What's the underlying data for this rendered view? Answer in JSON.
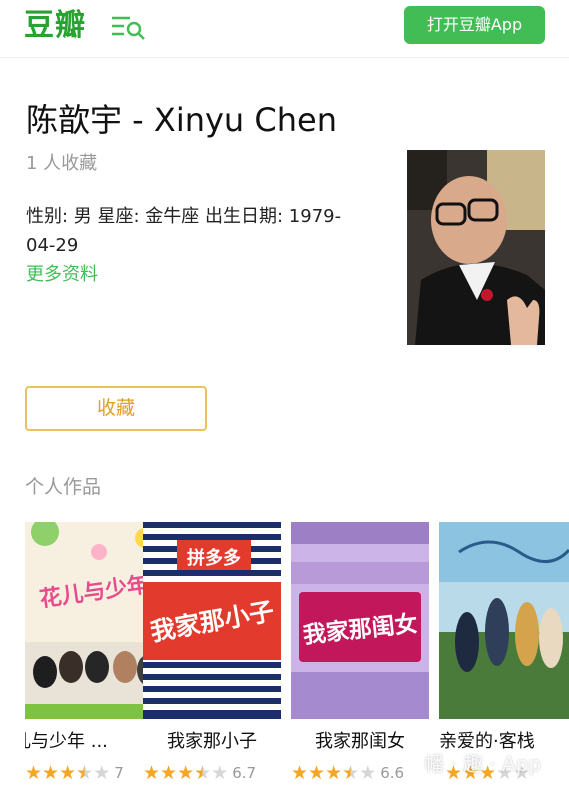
{
  "header": {
    "logo": "豆瓣",
    "menu_search_icon": "menu-search-icon",
    "open_app_label": "打开豆瓣App"
  },
  "person": {
    "name": "陈歆宇 - Xinyu Chen",
    "fav_count": "1 人收藏",
    "info": "性别: 男 星座: 金牛座 出生日期: 1979-04-29",
    "more_label": "更多资料"
  },
  "collect_label": "收藏",
  "works_section": {
    "title": "个人作品",
    "works": [
      {
        "title": "儿与少年 ...",
        "poster_text": "花儿与少年",
        "rating": 3.5,
        "score": "7",
        "colors": [
          "#f7efe0",
          "#e64c8c",
          "#7dc241"
        ]
      },
      {
        "title": "我家那小子",
        "poster_text_top": "拼多多",
        "poster_text": "我家那小子",
        "rating": 3.5,
        "score": "6.7",
        "colors": [
          "#1c2d6b",
          "#e33a2e",
          "#ffffff"
        ]
      },
      {
        "title": "我家那闺女",
        "poster_text": "我家那闺女",
        "rating": 3.5,
        "score": "6.6",
        "colors": [
          "#b58fd6",
          "#c2185b",
          "#ffffff"
        ]
      },
      {
        "title": "亲爱的·客栈",
        "poster_text": "",
        "rating": 3,
        "score": "",
        "colors": [
          "#8cc3e0",
          "#4a7b3a",
          "#e8d9c0"
        ]
      }
    ]
  },
  "watermark": "幡 · 趣 · App"
}
